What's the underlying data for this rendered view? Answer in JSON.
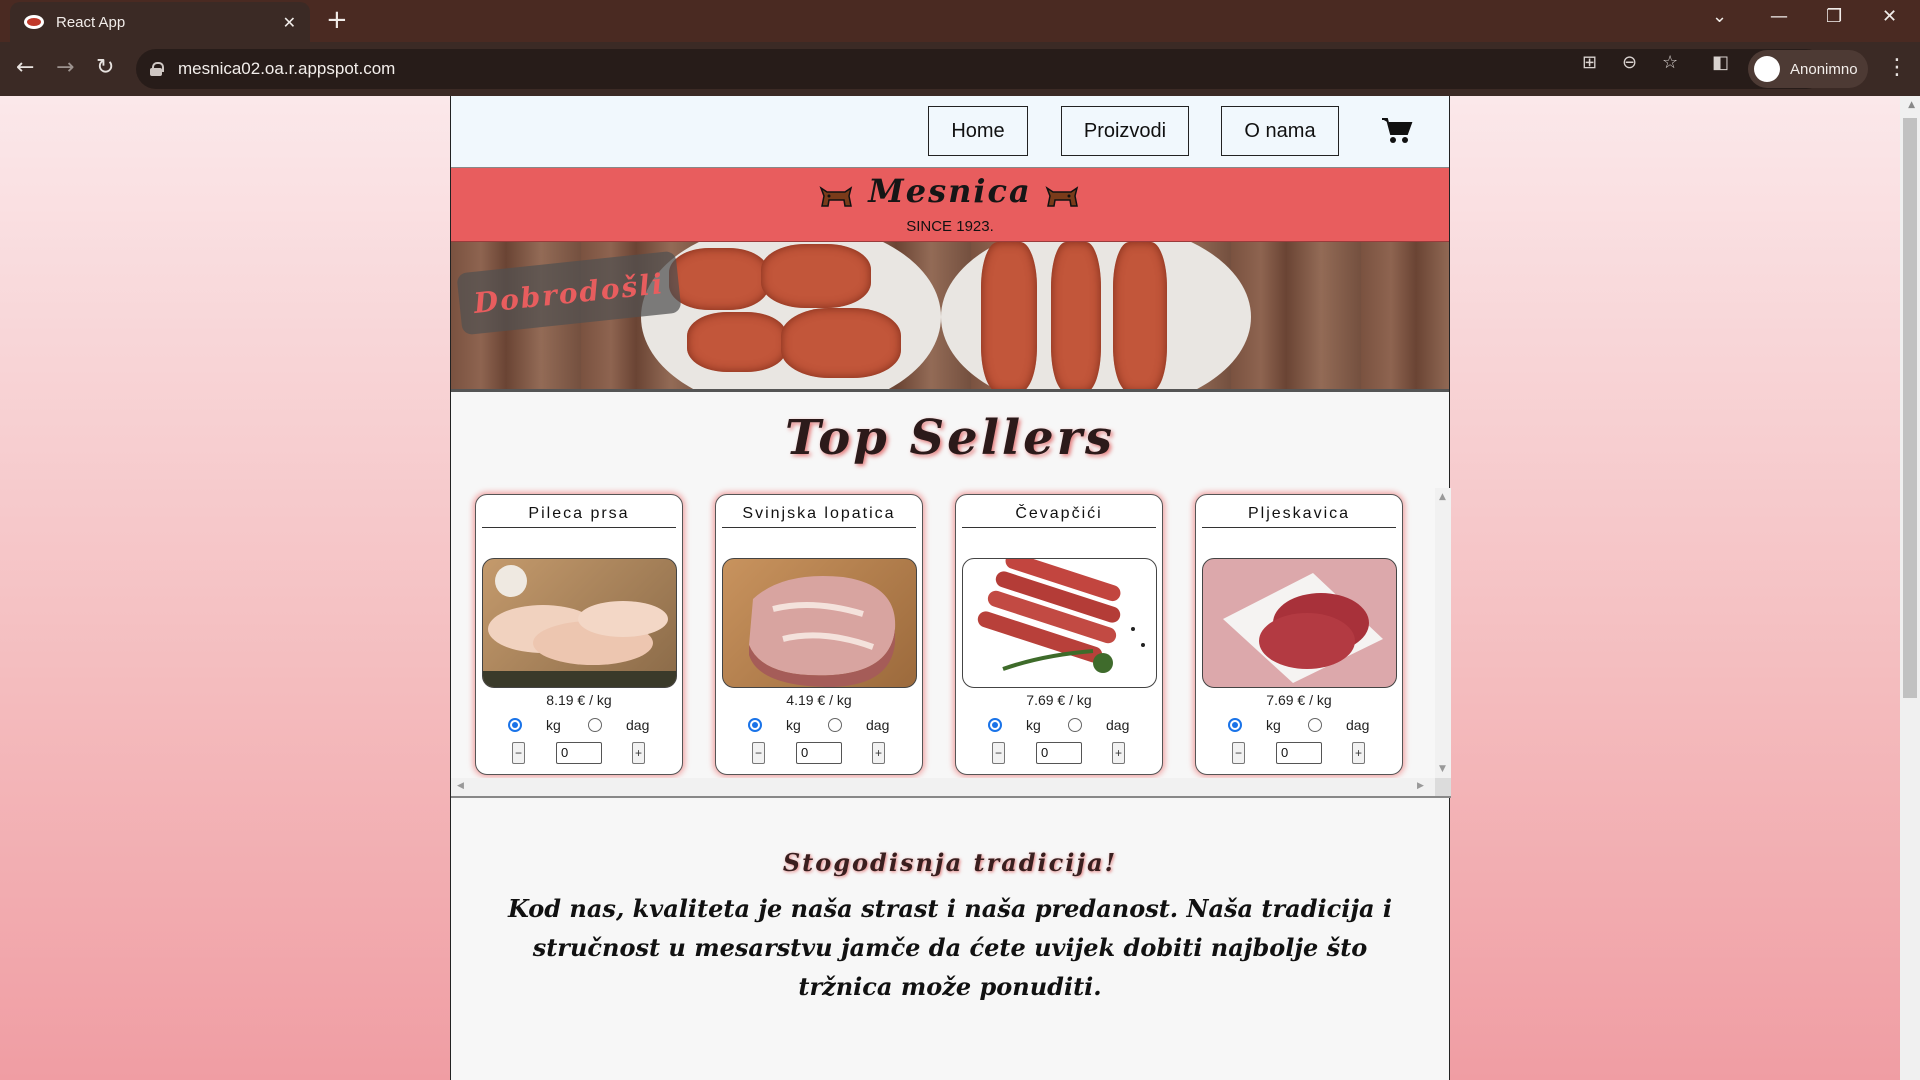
{
  "browser": {
    "tab_title": "React App",
    "url": "mesnica02.oa.r.appspot.com",
    "profile_label": "Anonimno"
  },
  "nav": {
    "links": [
      "Home",
      "Proizvodi",
      "O nama"
    ]
  },
  "banner": {
    "title": "Mesnica",
    "since": "SINCE 1923."
  },
  "hero": {
    "welcome": "Dobrodošli"
  },
  "top_sellers": {
    "title": "Top Sellers",
    "products": [
      {
        "name": "Pileca prsa",
        "price": "8.19 € / kg",
        "unit_kg": "kg",
        "unit_dag": "dag",
        "selected_unit": "kg",
        "quantity": "0",
        "image": "chicken-breast"
      },
      {
        "name": "Svinjska lopatica",
        "price": "4.19 € / kg",
        "unit_kg": "kg",
        "unit_dag": "dag",
        "selected_unit": "kg",
        "quantity": "0",
        "image": "pork-shoulder"
      },
      {
        "name": "Čevapčići",
        "price": "7.69 € / kg",
        "unit_kg": "kg",
        "unit_dag": "dag",
        "selected_unit": "kg",
        "quantity": "0",
        "image": "cevapcici"
      },
      {
        "name": "Pljeskavica",
        "price": "7.69 € / kg",
        "unit_kg": "kg",
        "unit_dag": "dag",
        "selected_unit": "kg",
        "quantity": "0",
        "image": "pljeskavica"
      }
    ],
    "minus_label": "−",
    "plus_label": "+"
  },
  "tradition": {
    "title": "Stogodisnja tradicija!",
    "text": "Kod nas, kvaliteta je naša strast i naša predanost. Naša tradicija i stručnost u mesarstvu jamče da ćete uvijek dobiti najbolje što tržnica može ponuditi."
  },
  "colors": {
    "banner": "#e85d5e",
    "chrome": "#3b2a25",
    "accent_radio": "#1a73e8"
  }
}
